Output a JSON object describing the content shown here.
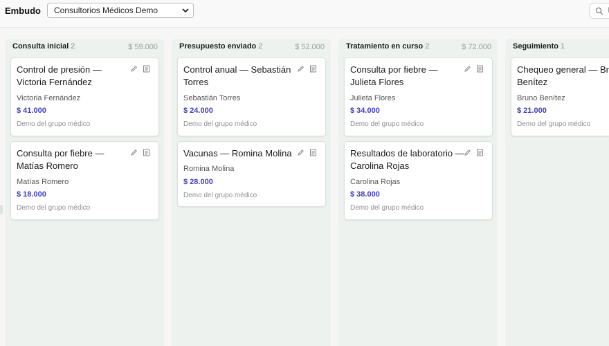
{
  "header": {
    "title": "Embudo",
    "org_select": "Consultorios Médicos Demo",
    "search_placeholder": "B"
  },
  "columns": [
    {
      "name": "Consulta inicial",
      "count": "2",
      "total": "$ 59.000",
      "cards": [
        {
          "title": "Control de presión — Victoria Fernández",
          "contact": "Victoria Fernández",
          "amount": "$ 41.000",
          "group": "Demo del grupo médico"
        },
        {
          "title": "Consulta por fiebre — Matías Romero",
          "contact": "Matías Romero",
          "amount": "$ 18.000",
          "group": "Demo del grupo médico"
        }
      ]
    },
    {
      "name": "Presupuesto enviado",
      "count": "2",
      "total": "$ 52.000",
      "cards": [
        {
          "title": "Control anual — Sebastián Torres",
          "contact": "Sebastián Torres",
          "amount": "$ 24.000",
          "group": "Demo del grupo médico"
        },
        {
          "title": "Vacunas — Romina Molina",
          "contact": "Romina Molina",
          "amount": "$ 28.000",
          "group": "Demo del grupo médico"
        }
      ]
    },
    {
      "name": "Tratamiento en curso",
      "count": "2",
      "total": "$ 72.000",
      "cards": [
        {
          "title": "Consulta por fiebre — Julieta Flores",
          "contact": "Julieta Flores",
          "amount": "$ 34.000",
          "group": "Demo del grupo médico"
        },
        {
          "title": "Resultados de laboratorio — Carolina Rojas",
          "contact": "Carolina Rojas",
          "amount": "$ 38.000",
          "group": "Demo del grupo médico"
        }
      ]
    },
    {
      "name": "Seguimiento",
      "count": "1",
      "total": "",
      "cards": [
        {
          "title": "Chequeo general — Bruno Benítez",
          "contact": "Bruno Benítez",
          "amount": "$ 21.000",
          "group": "Demo del grupo médico"
        }
      ]
    }
  ],
  "colors": {
    "accent": "#3d3fbf",
    "column_bg": "#eef2ef"
  },
  "icons": {
    "select": "chevron-down-icon",
    "search": "search-icon",
    "edit": "pencil-icon",
    "detail": "document-icon"
  }
}
